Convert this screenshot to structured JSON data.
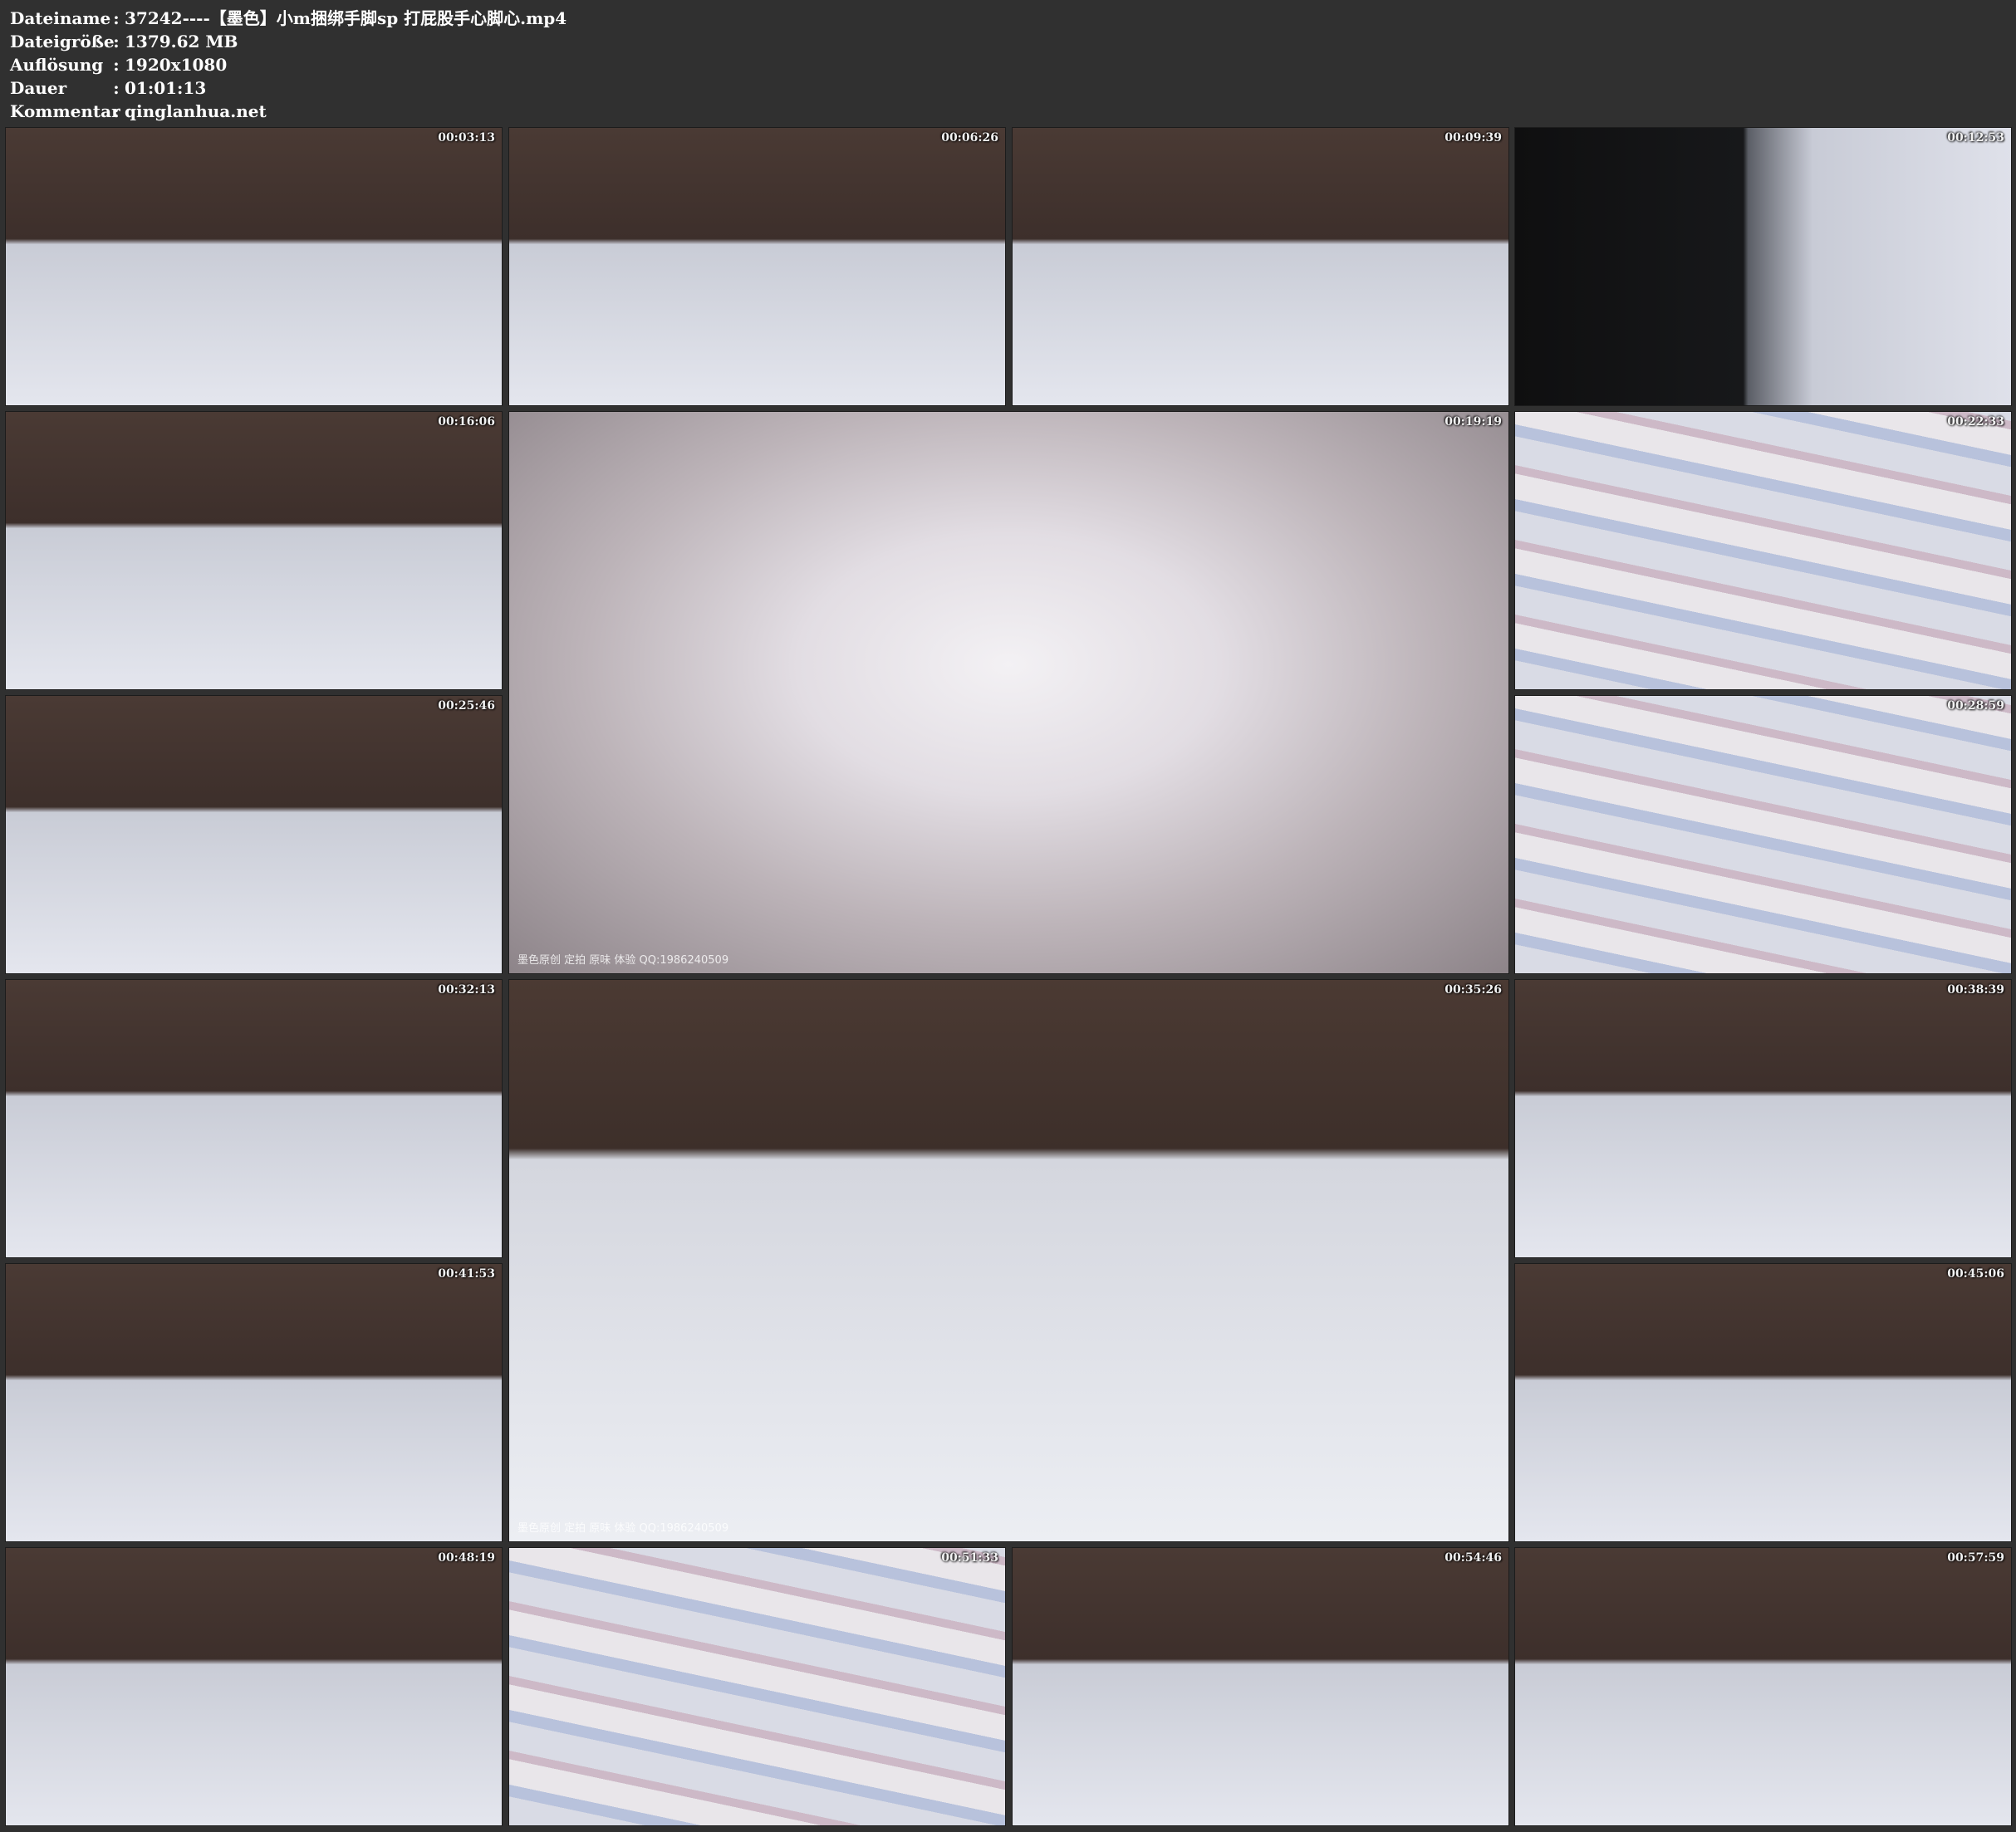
{
  "header": {
    "rows": [
      {
        "label": "Dateiname",
        "value": "37242----【墨色】小m捆绑手脚sp 打屁股手心脚心.mp4"
      },
      {
        "label": "Dateigröße",
        "value": "1379.62 MB"
      },
      {
        "label": "Auflösung",
        "value": "1920x1080"
      },
      {
        "label": "Dauer",
        "value": "01:01:13"
      },
      {
        "label": "Kommentar",
        "value": "qinglanhua.net"
      }
    ],
    "separator": ":"
  },
  "thumbnails": [
    {
      "time": "00:03:13",
      "scene": "room"
    },
    {
      "time": "00:06:26",
      "scene": "room"
    },
    {
      "time": "00:09:39",
      "scene": "room"
    },
    {
      "time": "00:12:53",
      "scene": "dark"
    },
    {
      "time": "00:16:06",
      "scene": "room"
    },
    {
      "time": "00:19:19",
      "scene": "closeup",
      "watermark": "墨色原创 定拍 原味 体验 QQ:1986240509"
    },
    {
      "time": "00:22:33",
      "scene": "bed"
    },
    {
      "time": "00:25:46",
      "scene": "room"
    },
    {
      "time": "00:28:59",
      "scene": "bed"
    },
    {
      "time": "00:32:13",
      "scene": "room"
    },
    {
      "time": "00:35:26",
      "scene": "wide",
      "watermark": "墨色原创 定拍 原味 体验 QQ:1986240509"
    },
    {
      "time": "00:38:39",
      "scene": "room"
    },
    {
      "time": "00:41:53",
      "scene": "room"
    },
    {
      "time": "00:45:06",
      "scene": "room"
    },
    {
      "time": "00:48:19",
      "scene": "room"
    },
    {
      "time": "00:51:33",
      "scene": "bed"
    },
    {
      "time": "00:54:46",
      "scene": "room"
    },
    {
      "time": "00:57:59",
      "scene": "room"
    }
  ]
}
